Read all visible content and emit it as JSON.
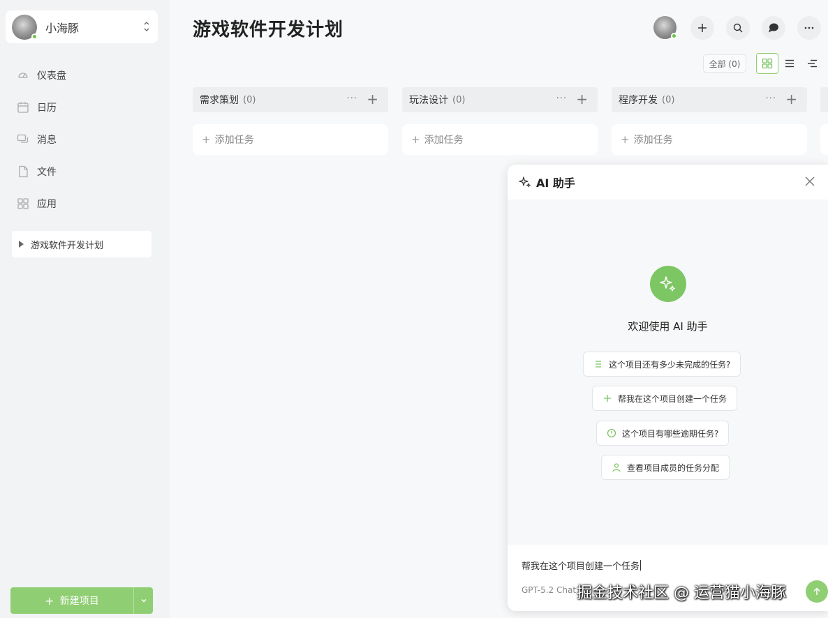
{
  "user": {
    "name": "小海豚"
  },
  "nav": {
    "items": [
      {
        "label": "仪表盘",
        "icon": "dashboard-icon"
      },
      {
        "label": "日历",
        "icon": "calendar-icon"
      },
      {
        "label": "消息",
        "icon": "message-icon"
      },
      {
        "label": "文件",
        "icon": "file-icon"
      },
      {
        "label": "应用",
        "icon": "apps-icon"
      }
    ]
  },
  "project": {
    "label": "游戏软件开发计划"
  },
  "new_project": {
    "label": "新建项目"
  },
  "page": {
    "title": "游戏软件开发计划"
  },
  "toolbar": {
    "filter_all": "全部 (0)"
  },
  "columns": [
    {
      "title": "需求策划",
      "count": "(0)",
      "add_task": "添加任务"
    },
    {
      "title": "玩法设计",
      "count": "(0)",
      "add_task": "添加任务"
    },
    {
      "title": "程序开发",
      "count": "(0)",
      "add_task": "添加任务"
    }
  ],
  "ai": {
    "title": "AI 助手",
    "welcome": "欢迎使用 AI 助手",
    "suggestions": [
      {
        "label": "这个项目还有多少未完成的任务?",
        "icon": "list-icon"
      },
      {
        "label": "帮我在这个项目创建一个任务",
        "icon": "plus-icon"
      },
      {
        "label": "这个项目有哪些逾期任务?",
        "icon": "clock-icon"
      },
      {
        "label": "查看项目成员的任务分配",
        "icon": "user-icon"
      }
    ],
    "input_value": "帮我在这个项目创建一个任务",
    "model": "GPT-5.2 Chat"
  },
  "watermark": "掘金技术社区 @ 运营猫小海豚",
  "colors": {
    "accent": "#8fce72",
    "online": "#6cc644"
  }
}
